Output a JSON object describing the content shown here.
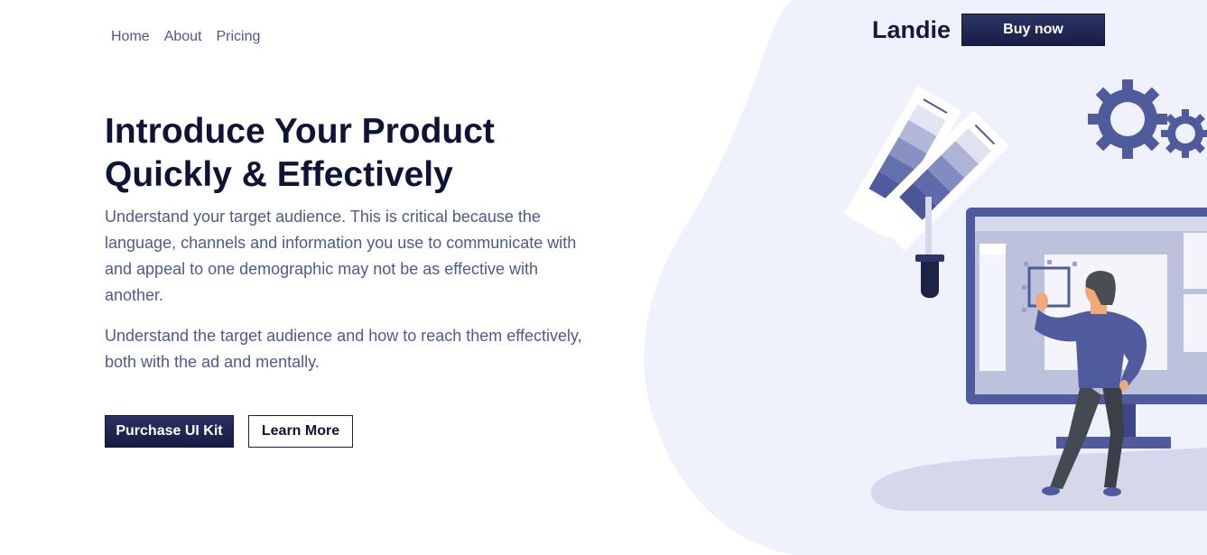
{
  "nav": {
    "items": [
      {
        "label": "Home"
      },
      {
        "label": "About"
      },
      {
        "label": "Pricing"
      }
    ]
  },
  "brand": {
    "name": "Landie"
  },
  "header": {
    "buy_label": "Buy now"
  },
  "hero": {
    "title_line1": "Introduce Your Product",
    "title_line2": "Quickly & Effectively",
    "paragraph1": "Understand your target audience. This is critical because the language, channels and information you use to communicate with and appeal to one demographic may not be as effective with another.",
    "paragraph2": "Understand the target audience and how to reach them effectively, both with the ad and mentally.",
    "primary_cta": "Purchase UI Kit",
    "secondary_cta": "Learn More"
  },
  "colors": {
    "navy": "#131a3c",
    "accent": "#4f5b9c",
    "text_muted": "#4e5b8a",
    "blob_bg": "#eff1fd"
  },
  "illustration": {
    "icons": [
      "gear-icon",
      "color-swatch-icon",
      "eyedropper-icon",
      "monitor-icon",
      "person-illustration"
    ]
  }
}
